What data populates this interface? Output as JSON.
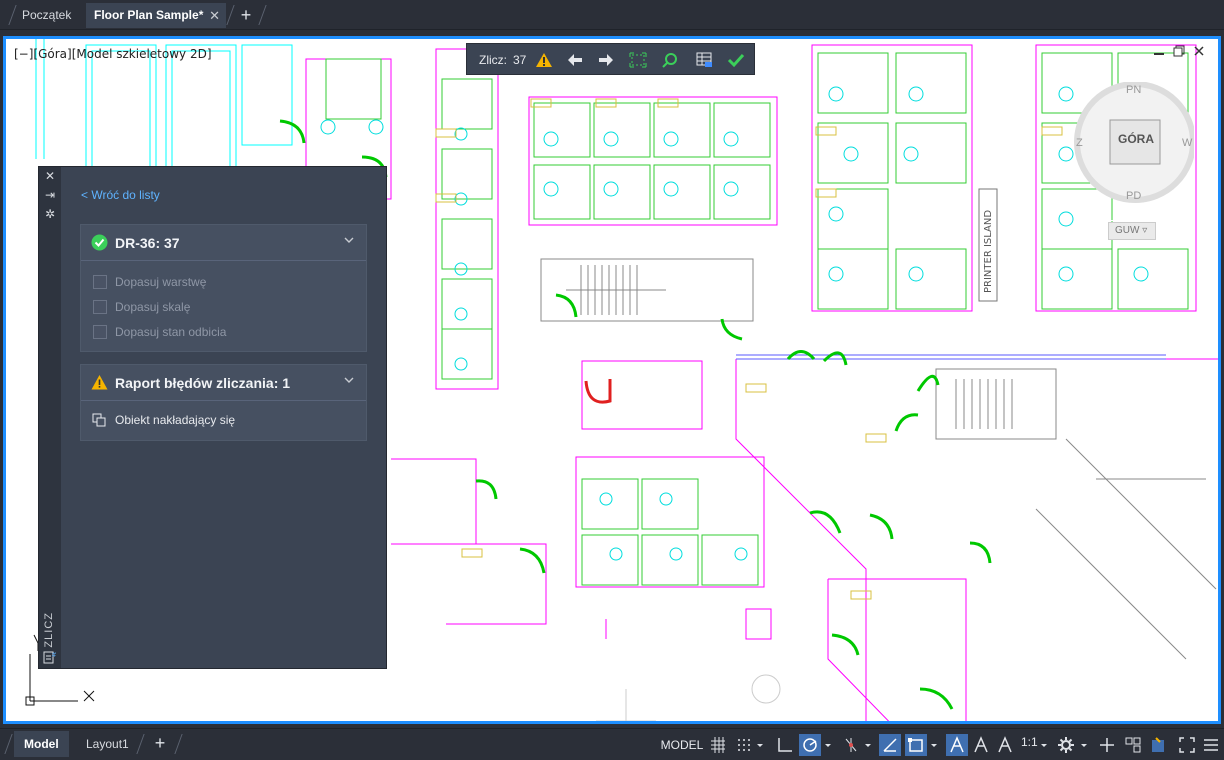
{
  "tabs": {
    "home_label": "Początek",
    "file_label": "Floor Plan Sample*",
    "close_glyph": "✕",
    "add_glyph": "+"
  },
  "viewport": {
    "label": "[−][Góra][Model szkieletowy 2D]",
    "accent_color": "#1e8fff"
  },
  "count_toolbar": {
    "label": "Zlicz:",
    "value": "37",
    "buttons": [
      "warning-icon",
      "arrow-left-icon",
      "arrow-right-icon",
      "zoom-extents-icon",
      "find-icon",
      "insert-table-icon",
      "check-icon"
    ]
  },
  "viewcube": {
    "top_label": "GÓRA",
    "n": "PN",
    "s": "PD",
    "e": "W",
    "w": "Z",
    "ucs_label": "GUW"
  },
  "drawing_labels": {
    "printer_island": "PRINTER ISLAND"
  },
  "panel": {
    "vertical_title": "ZLICZ",
    "back_link": "< Wróć do listy",
    "block_section": {
      "title": "DR-36: 37",
      "checks": [
        {
          "label": "Dopasuj warstwę"
        },
        {
          "label": "Dopasuj skalę"
        },
        {
          "label": "Dopasuj stan odbicia"
        }
      ]
    },
    "error_section": {
      "title": "Raport błędów zliczania: 1",
      "items": [
        {
          "label": "Obiekt nakładający się"
        }
      ]
    }
  },
  "statusbar": {
    "tabs": [
      "Model",
      "Layout1"
    ],
    "model_label": "MODEL",
    "scale_label": "1:1"
  },
  "colors": {
    "ui_dark": "#2b2f38",
    "panel": "#3b4453",
    "success": "#3bcf5a",
    "warning": "#f5b400",
    "error_door": "#e02020",
    "door": "#00c800"
  }
}
